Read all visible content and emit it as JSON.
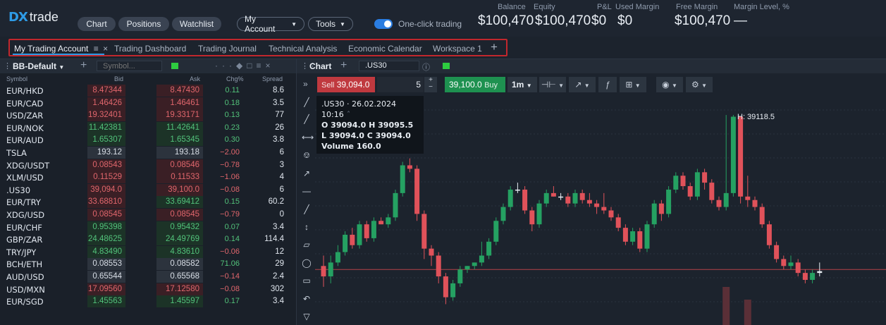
{
  "logo": {
    "mark": "DX",
    "text": "trade"
  },
  "nav": {
    "chart": "Chart",
    "positions": "Positions",
    "watchlist": "Watchlist",
    "my_account": "My Account",
    "tools": "Tools"
  },
  "one_click": {
    "label": "One-click trading",
    "enabled": true
  },
  "stats": [
    {
      "label": "Balance",
      "value": "$100,470"
    },
    {
      "label": "Equity",
      "value": "$100,470"
    },
    {
      "label": "P&L",
      "value": "$0"
    },
    {
      "label": "Used Margin",
      "value": "$0"
    },
    {
      "label": "Free Margin",
      "value": "$100,470"
    },
    {
      "label": "Margin Level, %",
      "value": "—"
    }
  ],
  "tabs": [
    "My Trading Account",
    "Trading Dashboard",
    "Trading Journal",
    "Technical Analysis",
    "Economic Calendar",
    "Workspace 1"
  ],
  "tab_icons": {
    "menu": "≡",
    "close": "×",
    "add": "+"
  },
  "watchlist": {
    "name": "BB-Default",
    "search_placeholder": "Symbol...",
    "columns": [
      "Symbol",
      "Bid",
      "Ask",
      "Chg%",
      "Spread"
    ],
    "rows": [
      {
        "symbol": "EUR/HKD",
        "bid": "8.47344",
        "ask": "8.47430",
        "chg": "0.11",
        "spread": "8.6",
        "bid_c": "red",
        "ask_c": "red",
        "dir": "up"
      },
      {
        "symbol": "EUR/CAD",
        "bid": "1.46426",
        "ask": "1.46461",
        "chg": "0.18",
        "spread": "3.5",
        "bid_c": "red",
        "ask_c": "red",
        "dir": "up"
      },
      {
        "symbol": "USD/ZAR",
        "bid": "19.32401",
        "ask": "19.33171",
        "chg": "0.13",
        "spread": "77",
        "bid_c": "red",
        "ask_c": "red",
        "dir": "up"
      },
      {
        "symbol": "EUR/NOK",
        "bid": "11.42381",
        "ask": "11.42641",
        "chg": "0.23",
        "spread": "26",
        "bid_c": "green",
        "ask_c": "green",
        "dir": "up"
      },
      {
        "symbol": "EUR/AUD",
        "bid": "1.65307",
        "ask": "1.65345",
        "chg": "0.30",
        "spread": "3.8",
        "bid_c": "green",
        "ask_c": "green",
        "dir": "up"
      },
      {
        "symbol": "TSLA",
        "bid": "193.12",
        "ask": "193.18",
        "chg": "−2.00",
        "spread": "6",
        "bid_c": "gray",
        "ask_c": "gray",
        "dir": "dn"
      },
      {
        "symbol": "XDG/USDT",
        "bid": "0.08543",
        "ask": "0.08546",
        "chg": "−0.78",
        "spread": "3",
        "bid_c": "red",
        "ask_c": "red",
        "dir": "dn"
      },
      {
        "symbol": "XLM/USD",
        "bid": "0.11529",
        "ask": "0.11533",
        "chg": "−1.06",
        "spread": "4",
        "bid_c": "red",
        "ask_c": "red",
        "dir": "dn"
      },
      {
        "symbol": ".US30",
        "bid": "39,094.0",
        "ask": "39,100.0",
        "chg": "−0.08",
        "spread": "6",
        "bid_c": "red",
        "ask_c": "red",
        "dir": "dn"
      },
      {
        "symbol": "EUR/TRY",
        "bid": "33.68810",
        "ask": "33.69412",
        "chg": "0.15",
        "spread": "60.2",
        "bid_c": "red",
        "ask_c": "green",
        "dir": "up"
      },
      {
        "symbol": "XDG/USD",
        "bid": "0.08545",
        "ask": "0.08545",
        "chg": "−0.79",
        "spread": "0",
        "bid_c": "red",
        "ask_c": "red",
        "dir": "dn"
      },
      {
        "symbol": "EUR/CHF",
        "bid": "0.95398",
        "ask": "0.95432",
        "chg": "0.07",
        "spread": "3.4",
        "bid_c": "green",
        "ask_c": "green",
        "dir": "up"
      },
      {
        "symbol": "GBP/ZAR",
        "bid": "24.48625",
        "ask": "24.49769",
        "chg": "0.14",
        "spread": "114.4",
        "bid_c": "green",
        "ask_c": "green",
        "dir": "up"
      },
      {
        "symbol": "TRY/JPY",
        "bid": "4.83490",
        "ask": "4.83610",
        "chg": "−0.06",
        "spread": "12",
        "bid_c": "green",
        "ask_c": "green",
        "dir": "dn"
      },
      {
        "symbol": "BCH/ETH",
        "bid": "0.08553",
        "ask": "0.08582",
        "chg": "71.06",
        "spread": "29",
        "bid_c": "gray",
        "ask_c": "gray",
        "dir": "up"
      },
      {
        "symbol": "AUD/USD",
        "bid": "0.65544",
        "ask": "0.65568",
        "chg": "−0.14",
        "spread": "2.4",
        "bid_c": "gray",
        "ask_c": "gray",
        "dir": "dn"
      },
      {
        "symbol": "USD/MXN",
        "bid": "17.09560",
        "ask": "17.12580",
        "chg": "−0.08",
        "spread": "302",
        "bid_c": "red",
        "ask_c": "red",
        "dir": "dn"
      },
      {
        "symbol": "EUR/SGD",
        "bid": "1.45563",
        "ask": "1.45597",
        "chg": "0.17",
        "spread": "3.4",
        "bid_c": "green",
        "ask_c": "green",
        "dir": "up"
      }
    ]
  },
  "chart": {
    "title": "Chart",
    "symbol": ".US30",
    "sell_label": "Sell",
    "sell_price": "39,094.0",
    "quantity": "5",
    "buy_price": "39,100.0",
    "buy_label": "Buy",
    "timeframe": "1m",
    "ohlc": {
      "header": ".US30 · 26.02.2024 10:16",
      "line1": "O 39094.0 H 39095.5",
      "line2": "L 39094.0 C 39094.0",
      "line3": "Volume 160.0"
    },
    "high_label": "H: 39118.5",
    "colors": {
      "bull": "#25a162",
      "bear": "#e0525a",
      "price_line": "#b4424a"
    }
  },
  "chart_data": {
    "type": "candlestick",
    "symbol": ".US30",
    "interval": "1m",
    "candles": [
      {
        "o": 39075,
        "c": 39072,
        "h": 39078,
        "l": 39069
      },
      {
        "o": 39072,
        "c": 39076,
        "h": 39078,
        "l": 39070
      },
      {
        "o": 39076,
        "c": 39079,
        "h": 39081,
        "l": 39075
      },
      {
        "o": 39079,
        "c": 39084,
        "h": 39085,
        "l": 39078
      },
      {
        "o": 39084,
        "c": 39081,
        "h": 39086,
        "l": 39080
      },
      {
        "o": 39081,
        "c": 39087,
        "h": 39088,
        "l": 39080
      },
      {
        "o": 39087,
        "c": 39083,
        "h": 39088,
        "l": 39082
      },
      {
        "o": 39083,
        "c": 39088,
        "h": 39089,
        "l": 39082
      },
      {
        "o": 39088,
        "c": 39087,
        "h": 39089,
        "l": 39087
      },
      {
        "o": 39087,
        "c": 39089,
        "h": 39090,
        "l": 39086
      },
      {
        "o": 39089,
        "c": 39096,
        "h": 39097,
        "l": 39088
      },
      {
        "o": 39096,
        "c": 39104,
        "h": 39105,
        "l": 39095
      },
      {
        "o": 39104,
        "c": 39103,
        "h": 39106,
        "l": 39102
      },
      {
        "o": 39103,
        "c": 39090,
        "h": 39104,
        "l": 39088
      },
      {
        "o": 39090,
        "c": 39080,
        "h": 39091,
        "l": 39077
      },
      {
        "o": 39080,
        "c": 39078,
        "h": 39081,
        "l": 39075
      },
      {
        "o": 39078,
        "c": 39072,
        "h": 39079,
        "l": 39070
      },
      {
        "o": 39072,
        "c": 39066,
        "h": 39073,
        "l": 39064
      },
      {
        "o": 39066,
        "c": 39070,
        "h": 39071,
        "l": 39065
      },
      {
        "o": 39070,
        "c": 39074,
        "h": 39075,
        "l": 39069
      },
      {
        "o": 39074,
        "c": 39075,
        "h": 39075,
        "l": 39073
      },
      {
        "o": 39075,
        "c": 39076,
        "h": 39076,
        "l": 39074
      },
      {
        "o": 39076,
        "c": 39078,
        "h": 39082,
        "l": 39075
      },
      {
        "o": 39078,
        "c": 39082,
        "h": 39083,
        "l": 39077
      },
      {
        "o": 39082,
        "c": 39088,
        "h": 39089,
        "l": 39081
      },
      {
        "o": 39088,
        "c": 39092,
        "h": 39093,
        "l": 39087
      },
      {
        "o": 39092,
        "c": 39097,
        "h": 39098,
        "l": 39091
      },
      {
        "o": 39097,
        "c": 39097,
        "h": 39099,
        "l": 39096
      },
      {
        "o": 39097,
        "c": 39091,
        "h": 39098,
        "l": 39090
      },
      {
        "o": 39091,
        "c": 39087,
        "h": 39092,
        "l": 39085
      },
      {
        "o": 39087,
        "c": 39093,
        "h": 39094,
        "l": 39086
      },
      {
        "o": 39093,
        "c": 39096,
        "h": 39097,
        "l": 39092
      },
      {
        "o": 39096,
        "c": 39095,
        "h": 39098,
        "l": 39095
      },
      {
        "o": 39095,
        "c": 39095,
        "h": 39096,
        "l": 39094
      },
      {
        "o": 39095,
        "c": 39093,
        "h": 39096,
        "l": 39092
      },
      {
        "o": 39093,
        "c": 39096,
        "h": 39097,
        "l": 39092
      },
      {
        "o": 39096,
        "c": 39094,
        "h": 39097,
        "l": 39093
      },
      {
        "o": 39094,
        "c": 39093,
        "h": 39096,
        "l": 39092
      },
      {
        "o": 39093,
        "c": 39092,
        "h": 39094,
        "l": 39090
      },
      {
        "o": 39092,
        "c": 39091,
        "h": 39096,
        "l": 39090
      },
      {
        "o": 39091,
        "c": 39089,
        "h": 39092,
        "l": 39088
      },
      {
        "o": 39089,
        "c": 39086,
        "h": 39090,
        "l": 39085
      },
      {
        "o": 39086,
        "c": 39082,
        "h": 39087,
        "l": 39081
      },
      {
        "o": 39082,
        "c": 39085,
        "h": 39086,
        "l": 39081
      },
      {
        "o": 39085,
        "c": 39080,
        "h": 39086,
        "l": 39079
      },
      {
        "o": 39080,
        "c": 39087,
        "h": 39088,
        "l": 39079
      },
      {
        "o": 39087,
        "c": 39093,
        "h": 39094,
        "l": 39086
      },
      {
        "o": 39093,
        "c": 39090,
        "h": 39094,
        "l": 39088
      },
      {
        "o": 39090,
        "c": 39097,
        "h": 39098,
        "l": 39089
      },
      {
        "o": 39097,
        "c": 39101,
        "h": 39102,
        "l": 39096
      },
      {
        "o": 39101,
        "c": 39098,
        "h": 39102,
        "l": 39097
      },
      {
        "o": 39098,
        "c": 39095,
        "h": 39099,
        "l": 39094
      },
      {
        "o": 39095,
        "c": 39102,
        "h": 39103,
        "l": 39094
      },
      {
        "o": 39102,
        "c": 39099,
        "h": 39103,
        "l": 39097
      },
      {
        "o": 39099,
        "c": 39094,
        "h": 39100,
        "l": 39093
      },
      {
        "o": 39094,
        "c": 39092,
        "h": 39095,
        "l": 39091
      },
      {
        "o": 39092,
        "c": 39096,
        "h": 39118.5,
        "l": 39091
      },
      {
        "o": 39096,
        "c": 39118,
        "h": 39118.5,
        "l": 39095
      },
      {
        "o": 39118,
        "c": 39095,
        "h": 39118,
        "l": 39093
      },
      {
        "o": 39095,
        "c": 39094,
        "h": 39101,
        "l": 39092
      },
      {
        "o": 39094,
        "c": 39092,
        "h": 39095,
        "l": 39091
      },
      {
        "o": 39092,
        "c": 39087,
        "h": 39093,
        "l": 39086
      },
      {
        "o": 39087,
        "c": 39081,
        "h": 39088,
        "l": 39080
      },
      {
        "o": 39081,
        "c": 39077,
        "h": 39082,
        "l": 39076
      },
      {
        "o": 39077,
        "c": 39075,
        "h": 39078,
        "l": 39074
      },
      {
        "o": 39075,
        "c": 39076,
        "h": 39078,
        "l": 39074
      },
      {
        "o": 39076,
        "c": 39073,
        "h": 39077,
        "l": 39072
      },
      {
        "o": 39073,
        "c": 39071,
        "h": 39074,
        "l": 39070
      },
      {
        "o": 39071,
        "c": 39073,
        "h": 39074,
        "l": 39070
      },
      {
        "o": 39073,
        "c": 39073.5,
        "h": 39076,
        "l": 39072
      }
    ],
    "last_price": 39074,
    "volume_bars": [
      0,
      0,
      0,
      0,
      0,
      0,
      0,
      0,
      0,
      0,
      0,
      0,
      0,
      0,
      0,
      0,
      0,
      0,
      0,
      0,
      0,
      0,
      0,
      0,
      0,
      0,
      0,
      0,
      0,
      0,
      0,
      0,
      0,
      0,
      0,
      0,
      0,
      0,
      0,
      0,
      0,
      0,
      0,
      0,
      0,
      0,
      0,
      0,
      0,
      0,
      0,
      0,
      0,
      0,
      0,
      0,
      0.9,
      0,
      0,
      0.6,
      0,
      0,
      0,
      0,
      0,
      0,
      0,
      0,
      0,
      0
    ],
    "ylim": [
      39058,
      39124
    ]
  }
}
